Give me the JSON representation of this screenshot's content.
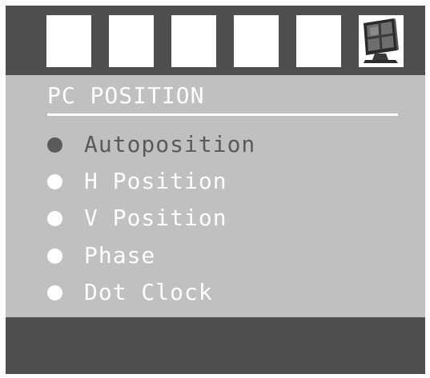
{
  "osd": {
    "title": "PC POSITION",
    "tabs": [
      {
        "icon": "blank-tab-icon"
      },
      {
        "icon": "blank-tab-icon"
      },
      {
        "icon": "blank-tab-icon"
      },
      {
        "icon": "blank-tab-icon"
      },
      {
        "icon": "blank-tab-icon"
      },
      {
        "icon": "pc-monitor-icon",
        "selected": true
      }
    ],
    "menu": [
      {
        "label": "Autoposition",
        "selected": true
      },
      {
        "label": "H Position"
      },
      {
        "label": "V Position"
      },
      {
        "label": "Phase"
      },
      {
        "label": "Dot Clock"
      }
    ]
  },
  "colors": {
    "frame": "#4f4f4f",
    "panel": "#c0c0c0",
    "text": "#ffffff",
    "selected": "#5a5a5a"
  }
}
